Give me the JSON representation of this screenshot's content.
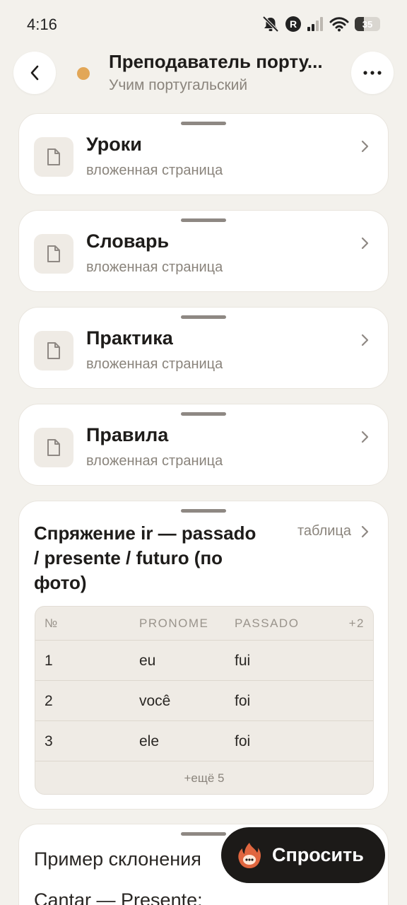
{
  "status_bar": {
    "time": "4:16",
    "network_badge": "R",
    "battery_level": "35"
  },
  "header": {
    "title": "Преподаватель порту...",
    "subtitle": "Учим португальский",
    "accent_color": "#E2A757"
  },
  "pages": [
    {
      "title": "Уроки",
      "subtitle": "вложенная страница",
      "icon": "document-icon"
    },
    {
      "title": "Словарь",
      "subtitle": "вложенная страница",
      "icon": "document-icon"
    },
    {
      "title": "Практика",
      "subtitle": "вложенная страница",
      "icon": "document-icon"
    },
    {
      "title": "Правила",
      "subtitle": "вложенная страница",
      "icon": "document-icon"
    }
  ],
  "table_block": {
    "title": "Спряжение ir — passado / presente / futuro (по фото)",
    "link_label": "таблица",
    "columns": [
      "№",
      "PRONOME",
      "PASSADO",
      "+2"
    ],
    "rows": [
      [
        "1",
        "eu",
        "fui"
      ],
      [
        "2",
        "você",
        "foi"
      ],
      [
        "3",
        "ele",
        "foi"
      ]
    ],
    "more_label": "+ещё 5"
  },
  "next_block": {
    "line1": "Пример склонения",
    "line2": "Cantar — Presente:"
  },
  "ask_button": {
    "label": "Спросить"
  }
}
